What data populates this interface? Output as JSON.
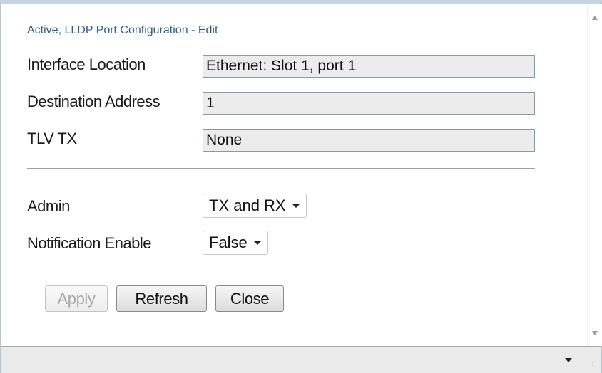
{
  "dialog": {
    "title": "Active, LLDP Port Configuration - Edit"
  },
  "fields": {
    "interface_location": {
      "label": "Interface Location",
      "value": "Ethernet: Slot 1, port 1"
    },
    "destination_address": {
      "label": "Destination Address",
      "value": "1"
    },
    "tlv_tx": {
      "label": "TLV TX",
      "value": "None"
    },
    "admin": {
      "label": "Admin",
      "selected": "TX and RX"
    },
    "notification_enable": {
      "label": "Notification Enable",
      "selected": "False"
    }
  },
  "buttons": {
    "apply": "Apply",
    "refresh": "Refresh",
    "close": "Close"
  },
  "icons": {
    "scroll_up": "scroll-up-arrow-icon",
    "scroll_down": "scroll-down-arrow-icon",
    "status_dropdown": "dropdown-caret-icon",
    "resize_grip": "resize-grip-icon"
  },
  "colors": {
    "title_text": "#2f5e8c",
    "readonly_field_bg": "#ececec",
    "field_border": "#7f9db9",
    "status_bar_bg": "#eaeaea"
  }
}
